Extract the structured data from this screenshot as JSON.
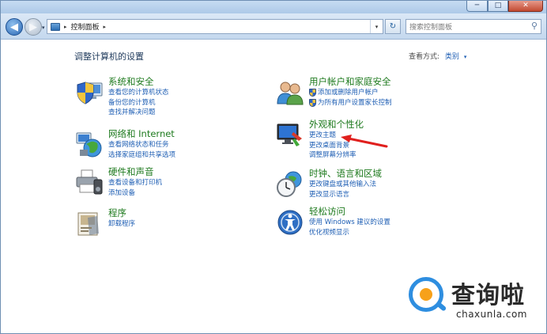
{
  "window": {
    "controls": {
      "minimize": "─",
      "maximize": "□",
      "close": "✕"
    }
  },
  "nav": {
    "back_icon": "back-arrow-icon",
    "forward_icon": "forward-arrow-icon",
    "back_glyph": "◀",
    "forward_glyph": "▶",
    "dropdown_glyph": "▾",
    "breadcrumb_separator": "▸",
    "breadcrumb_root": "控制面板",
    "breadcrumb_trailing": "▸",
    "address_dropdown": "▾",
    "refresh_glyph": "↻",
    "search_placeholder": "搜索控制面板",
    "search_glyph": "⚲"
  },
  "page": {
    "title": "调整计算机的设置",
    "view_by_label": "查看方式:",
    "view_by_value": "类别",
    "view_by_arrow": "▾"
  },
  "categories": [
    {
      "icon": "shield-computer-icon",
      "title": "系统和安全",
      "links": [
        "查看您的计算机状态",
        "备份您的计算机",
        "查找并解决问题"
      ]
    },
    {
      "icon": "network-globe-icon",
      "title": "网络和 Internet",
      "links": [
        "查看网络状态和任务",
        "选择家庭组和共享选项"
      ]
    },
    {
      "icon": "printer-speaker-icon",
      "title": "硬件和声音",
      "links": [
        "查看设备和打印机",
        "添加设备"
      ]
    },
    {
      "icon": "programs-box-icon",
      "title": "程序",
      "links": [
        "卸载程序"
      ]
    },
    {
      "icon": "users-icon",
      "title": "用户帐户和家庭安全",
      "links": [
        "添加或删除用户帐户",
        "为所有用户设置家长控制"
      ]
    },
    {
      "icon": "monitor-paint-icon",
      "title": "外观和个性化",
      "links": [
        "更改主题",
        "更改桌面背景",
        "调整屏幕分辨率"
      ]
    },
    {
      "icon": "clock-globe-icon",
      "title": "时钟、语言和区域",
      "links": [
        "更改键盘或其他输入法",
        "更改显示语言"
      ]
    },
    {
      "icon": "accessibility-icon",
      "title": "轻松访问",
      "links": [
        "使用 Windows 建议的设置",
        "优化视频显示"
      ]
    }
  ],
  "watermark": {
    "text": "查询啦",
    "url": "chaxunla.com"
  },
  "colors": {
    "category_title": "#1e7a1e",
    "link": "#1f5fb4",
    "annotation_arrow": "#e0201e"
  }
}
